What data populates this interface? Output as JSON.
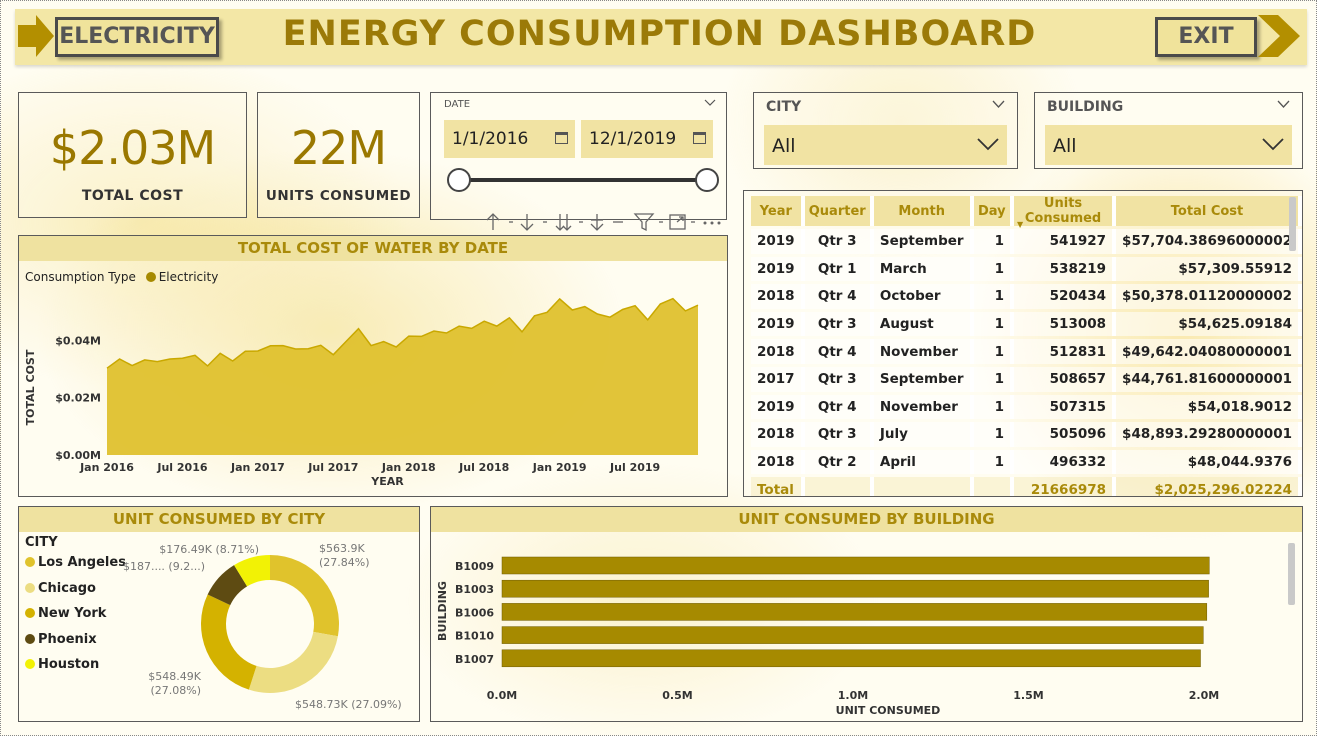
{
  "header": {
    "title": "ENERGY CONSUMPTION DASHBOARD",
    "left_button": "ELECTRICITY",
    "right_button": "EXIT"
  },
  "kpis": {
    "total_cost": {
      "value": "$2.03M",
      "label": "TOTAL COST"
    },
    "units_consumed": {
      "value": "22M",
      "label": "UNITS CONSUMED"
    }
  },
  "date_slicer": {
    "label": "DATE",
    "start": "1/1/2016",
    "end": "12/1/2019"
  },
  "city_slicer": {
    "label": "CITY",
    "value": "All"
  },
  "building_slicer": {
    "label": "BUILDING",
    "value": "All"
  },
  "visual_toolbar": {
    "icons": [
      "arrow-up-icon",
      "arrow-down-icon",
      "double-arrow-down-icon",
      "expand-hierarchy-icon",
      "filter-icon",
      "focus-mode-icon",
      "more-options-icon"
    ]
  },
  "colors": {
    "accent_gold": "#9b7a08",
    "area_fill": "#dfc12e",
    "bar_fill": "#a68a00",
    "header_bg": "#f3e7a6"
  },
  "table": {
    "columns": [
      "Year",
      "Quarter",
      "Month",
      "Day",
      "Units Consumed",
      "Total Cost"
    ],
    "sort_indicator": "▼",
    "rows": [
      [
        "2019",
        "Qtr 3",
        "September",
        "1",
        "541927",
        "$57,704.38696000002"
      ],
      [
        "2019",
        "Qtr 1",
        "March",
        "1",
        "538219",
        "$57,309.55912"
      ],
      [
        "2018",
        "Qtr 4",
        "October",
        "1",
        "520434",
        "$50,378.01120000002"
      ],
      [
        "2019",
        "Qtr 3",
        "August",
        "1",
        "513008",
        "$54,625.09184"
      ],
      [
        "2018",
        "Qtr 4",
        "November",
        "1",
        "512831",
        "$49,642.04080000001"
      ],
      [
        "2017",
        "Qtr 3",
        "September",
        "1",
        "508657",
        "$44,761.81600000001"
      ],
      [
        "2019",
        "Qtr 4",
        "November",
        "1",
        "507315",
        "$54,018.9012"
      ],
      [
        "2018",
        "Qtr 3",
        "July",
        "1",
        "505096",
        "$48,893.29280000001"
      ],
      [
        "2018",
        "Qtr 2",
        "April",
        "1",
        "496332",
        "$48,044.9376"
      ]
    ],
    "total": {
      "label": "Total",
      "units": "21666978",
      "cost": "$2,025,296.02224"
    }
  },
  "chart_data": [
    {
      "id": "area",
      "type": "area",
      "title": "TOTAL COST OF WATER BY DATE",
      "legend_title": "Consumption Type",
      "legend": "top-left",
      "series": [
        {
          "name": "Electricity",
          "color": "#dfc12e",
          "values": [
            0.0303,
            0.0335,
            0.0312,
            0.0332,
            0.0326,
            0.0335,
            0.0338,
            0.0348,
            0.0311,
            0.0355,
            0.0328,
            0.0362,
            0.0363,
            0.0381,
            0.0382,
            0.037,
            0.0371,
            0.0383,
            0.035,
            0.0396,
            0.0441,
            0.0382,
            0.0396,
            0.0377,
            0.0415,
            0.0414,
            0.0433,
            0.0426,
            0.045,
            0.0442,
            0.0467,
            0.045,
            0.0479,
            0.043,
            0.0486,
            0.0498,
            0.0545,
            0.0506,
            0.0518,
            0.0492,
            0.0481,
            0.0508,
            0.0521,
            0.0472,
            0.0527,
            0.0546,
            0.0503,
            0.0523
          ]
        }
      ],
      "x_start": "Jan 2016",
      "x_end": "Dec 2019",
      "xticks": [
        "Jan 2016",
        "Jul 2016",
        "Jan 2017",
        "Jul 2017",
        "Jan 2018",
        "Jul 2018",
        "Jan 2019",
        "Jul 2019"
      ],
      "yticks": [
        "$0.00M",
        "$0.02M",
        "$0.04M"
      ],
      "ylim": [
        0,
        0.0555
      ],
      "xlabel": "YEAR",
      "ylabel": "TOTAL COST"
    },
    {
      "id": "donut",
      "type": "pie",
      "title": "UNIT CONSUMED BY CITY",
      "legend_title": "CITY",
      "legend": "left",
      "slices": [
        {
          "name": "Los Angeles",
          "value": 563.9,
          "label": "$563.9K\n(27.84%)",
          "color": "#e0c32c"
        },
        {
          "name": "Chicago",
          "value": 548.73,
          "label": "$548.73K (27.09%)",
          "color": "#ecdd82"
        },
        {
          "name": "New York",
          "value": 548.49,
          "label": "$548.49K\n(27.08%)",
          "color": "#d4b200"
        },
        {
          "name": "Phoenix",
          "value": 187.0,
          "label": "$187.... (9.2...)",
          "color": "#5e4b12"
        },
        {
          "name": "Houston",
          "value": 176.49,
          "label": "$176.49K (8.71%)",
          "color": "#f2f205"
        }
      ]
    },
    {
      "id": "hbar",
      "type": "bar",
      "orientation": "horizontal",
      "title": "UNIT CONSUMED BY BUILDING",
      "categories": [
        "B1009",
        "B1003",
        "B1006",
        "B1010",
        "B1007"
      ],
      "values": [
        2.015,
        2.013,
        2.008,
        1.998,
        1.99
      ],
      "xticks": [
        "0.0M",
        "0.5M",
        "1.0M",
        "1.5M",
        "2.0M"
      ],
      "xlim": [
        0,
        2.0
      ],
      "xlabel": "UNIT CONSUMED",
      "ylabel": "BUILDING"
    }
  ]
}
